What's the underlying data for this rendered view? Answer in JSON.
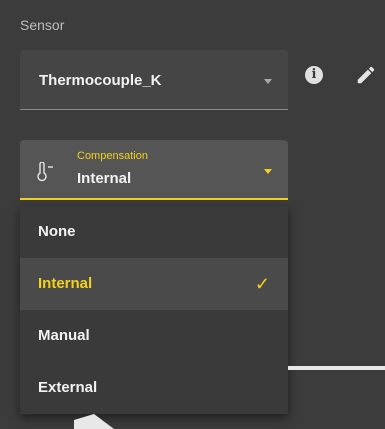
{
  "sensor": {
    "section_label": "Sensor",
    "selected_value": "Thermocouple_K",
    "info_glyph": "i",
    "icons": [
      "chevron-down-icon",
      "info-icon",
      "edit-icon"
    ]
  },
  "compensation": {
    "label": "Compensation",
    "selected_value": "Internal",
    "icon": "thermometer-icon",
    "accent_color": "#f2d21b",
    "options": [
      {
        "label": "None",
        "selected": false
      },
      {
        "label": "Internal",
        "selected": true
      },
      {
        "label": "Manual",
        "selected": false
      },
      {
        "label": "External",
        "selected": false
      }
    ]
  }
}
